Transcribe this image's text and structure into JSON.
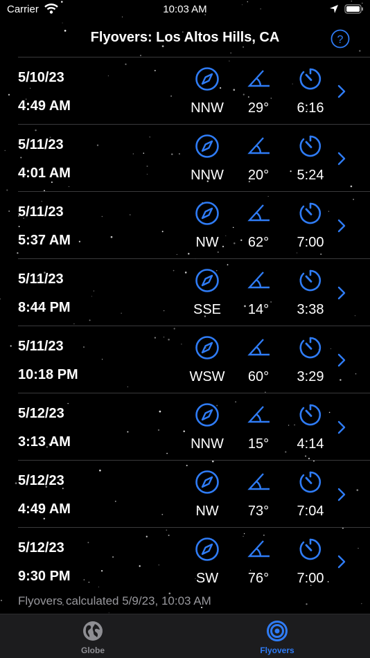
{
  "status_bar": {
    "carrier": "Carrier",
    "time": "10:03 AM"
  },
  "nav": {
    "title": "Flyovers: Los Altos Hills, CA",
    "help_icon": "question-circle-icon"
  },
  "icons": {
    "direction": "compass-icon",
    "elevation": "angle-icon",
    "duration": "timer-icon",
    "disclosure": "chevron-right-icon"
  },
  "flyovers": [
    {
      "date": "5/10/23",
      "time": "4:49 AM",
      "direction": "NNW",
      "elevation": "29°",
      "duration": "6:16"
    },
    {
      "date": "5/11/23",
      "time": "4:01 AM",
      "direction": "NNW",
      "elevation": "20°",
      "duration": "5:24"
    },
    {
      "date": "5/11/23",
      "time": "5:37 AM",
      "direction": "NW",
      "elevation": "62°",
      "duration": "7:00"
    },
    {
      "date": "5/11/23",
      "time": "8:44 PM",
      "direction": "SSE",
      "elevation": "14°",
      "duration": "3:38"
    },
    {
      "date": "5/11/23",
      "time": "10:18 PM",
      "direction": "WSW",
      "elevation": "60°",
      "duration": "3:29"
    },
    {
      "date": "5/12/23",
      "time": "3:13 AM",
      "direction": "NNW",
      "elevation": "15°",
      "duration": "4:14"
    },
    {
      "date": "5/12/23",
      "time": "4:49 AM",
      "direction": "NW",
      "elevation": "73°",
      "duration": "7:04"
    },
    {
      "date": "5/12/23",
      "time": "9:30 PM",
      "direction": "SW",
      "elevation": "76°",
      "duration": "7:00"
    }
  ],
  "footer": "Flyovers calculated 5/9/23, 10:03 AM",
  "tabs": [
    {
      "label": "Globe",
      "icon": "globe-icon",
      "selected": false
    },
    {
      "label": "Flyovers",
      "icon": "flyovers-target-icon",
      "selected": true
    }
  ],
  "colors": {
    "accent": "#2f7cf6",
    "background": "#000000",
    "tabbar": "#1c1c1e",
    "secondary_text": "#98989d"
  }
}
